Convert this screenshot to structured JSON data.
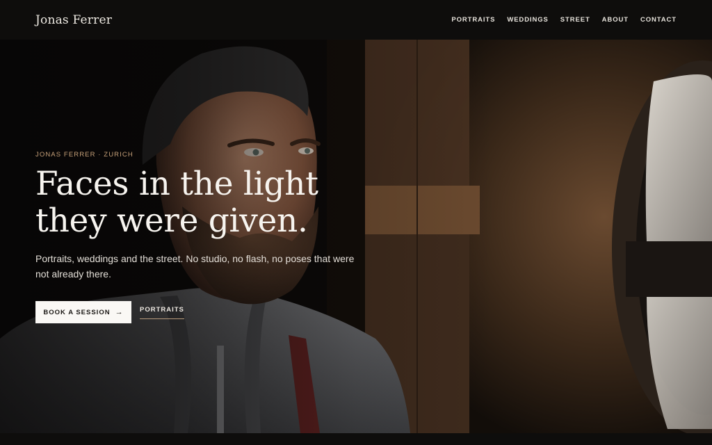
{
  "header": {
    "brand": "Jonas Ferrer",
    "nav": [
      "PORTRAITS",
      "WEDDINGS",
      "STREET",
      "ABOUT",
      "CONTACT"
    ]
  },
  "hero": {
    "eyebrow": "JONAS FERRER · ZURICH",
    "headline_line1": "Faces in the light",
    "headline_line2": "they were given.",
    "subtitle": "Portraits, weddings and the street. No studio, no flash, no poses that were not already there.",
    "primary_cta": "BOOK A SESSION",
    "primary_cta_icon": "arrow-right-icon",
    "secondary_cta": "PORTRAITS"
  },
  "colors": {
    "background": "#0e0d0c",
    "accent": "#c9a27a",
    "button_bg": "#faf8f5"
  }
}
